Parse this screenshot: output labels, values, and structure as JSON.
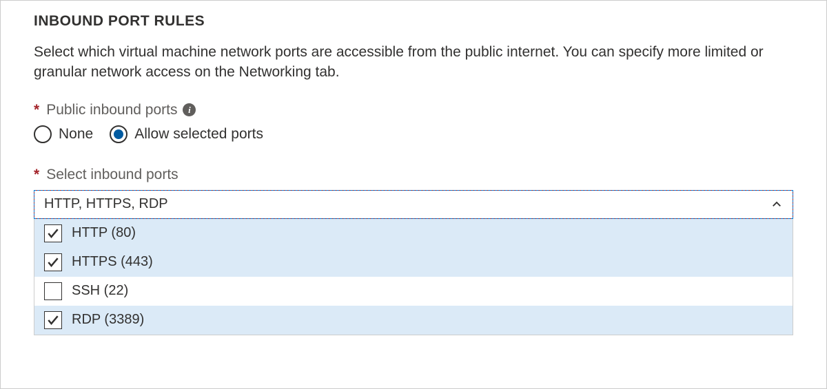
{
  "section": {
    "title": "INBOUND PORT RULES",
    "description": "Select which virtual machine network ports are accessible from the public internet. You can specify more limited or granular network access on the Networking tab."
  },
  "publicInboundPorts": {
    "label": "Public inbound ports",
    "options": [
      {
        "label": "None",
        "selected": false
      },
      {
        "label": "Allow selected ports",
        "selected": true
      }
    ]
  },
  "selectInboundPorts": {
    "label": "Select inbound ports",
    "value": "HTTP, HTTPS, RDP",
    "options": [
      {
        "label": "HTTP (80)",
        "checked": true
      },
      {
        "label": "HTTPS (443)",
        "checked": true
      },
      {
        "label": "SSH (22)",
        "checked": false
      },
      {
        "label": "RDP (3389)",
        "checked": true
      }
    ]
  }
}
